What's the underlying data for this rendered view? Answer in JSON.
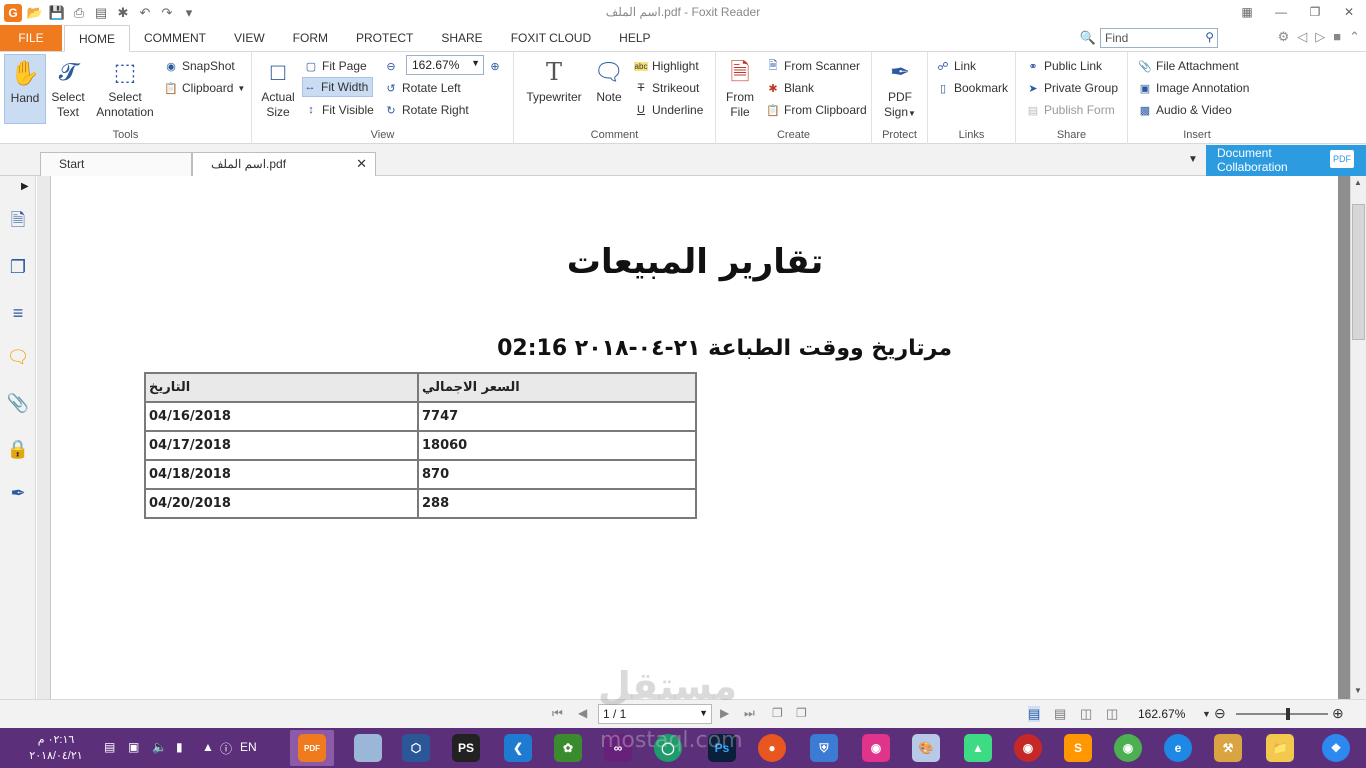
{
  "window": {
    "title": "اسم الملف.pdf - Foxit Reader"
  },
  "ribbon_tabs": [
    "FILE",
    "HOME",
    "COMMENT",
    "VIEW",
    "FORM",
    "PROTECT",
    "SHARE",
    "FOXIT CLOUD",
    "HELP"
  ],
  "find": {
    "placeholder": "Find"
  },
  "tools": {
    "hand": "Hand",
    "select_text_1": "Select",
    "select_text_2": "Text",
    "select_annotation_1": "Select",
    "select_annotation_2": "Annotation",
    "snapshot": "SnapShot",
    "clipboard": "Clipboard",
    "label": "Tools"
  },
  "view": {
    "actual_size_1": "Actual",
    "actual_size_2": "Size",
    "fit_page": "Fit Page",
    "fit_width": "Fit Width",
    "fit_visible": "Fit Visible",
    "zoom_value": "162.67%",
    "rotate_left": "Rotate Left",
    "rotate_right": "Rotate Right",
    "label": "View"
  },
  "comment": {
    "typewriter": "Typewriter",
    "note": "Note",
    "highlight": "Highlight",
    "strikeout": "Strikeout",
    "underline": "Underline",
    "label": "Comment"
  },
  "create": {
    "from_file_1": "From",
    "from_file_2": "File",
    "from_scanner": "From Scanner",
    "blank": "Blank",
    "from_clipboard": "From Clipboard",
    "label": "Create"
  },
  "protect": {
    "pdf_sign_1": "PDF",
    "pdf_sign_2": "Sign",
    "label": "Protect"
  },
  "links": {
    "link": "Link",
    "bookmark": "Bookmark",
    "label": "Links"
  },
  "share": {
    "public_link": "Public Link",
    "private_group": "Private Group",
    "publish_form": "Publish Form",
    "label": "Share"
  },
  "insert": {
    "file_attachment": "File Attachment",
    "image_annotation": "Image Annotation",
    "audio_video": "Audio & Video",
    "label": "Insert"
  },
  "doc_tabs": {
    "start": "Start",
    "current": "اسم الملف.pdf",
    "collab_1": "Document",
    "collab_2": "Collaboration",
    "collab_badge": "PDF"
  },
  "document": {
    "title": "تقارير المبيعات",
    "subtitle": "02:16 مرتاريخ ووقت الطباعة ٢١-٠٤-٢٠١٨",
    "table": {
      "headers": [
        "التاريخ",
        "السعر الاجمالي"
      ],
      "rows": [
        [
          "04/16/2018",
          "7747"
        ],
        [
          "04/17/2018",
          "18060"
        ],
        [
          "04/18/2018",
          "870"
        ],
        [
          "04/20/2018",
          "288"
        ]
      ]
    }
  },
  "statusbar": {
    "page": "1 / 1",
    "zoom": "162.67%"
  },
  "watermark": {
    "arabic": "مستقل",
    "latin": "mostaql.com"
  },
  "taskbar": {
    "time": "٠٢:١٦ م",
    "date": "٢٠١٨/٠٤/٢١",
    "lang": "EN",
    "foxit_badge": "PDF",
    "ps": "PS",
    "ps2": "Ps"
  }
}
